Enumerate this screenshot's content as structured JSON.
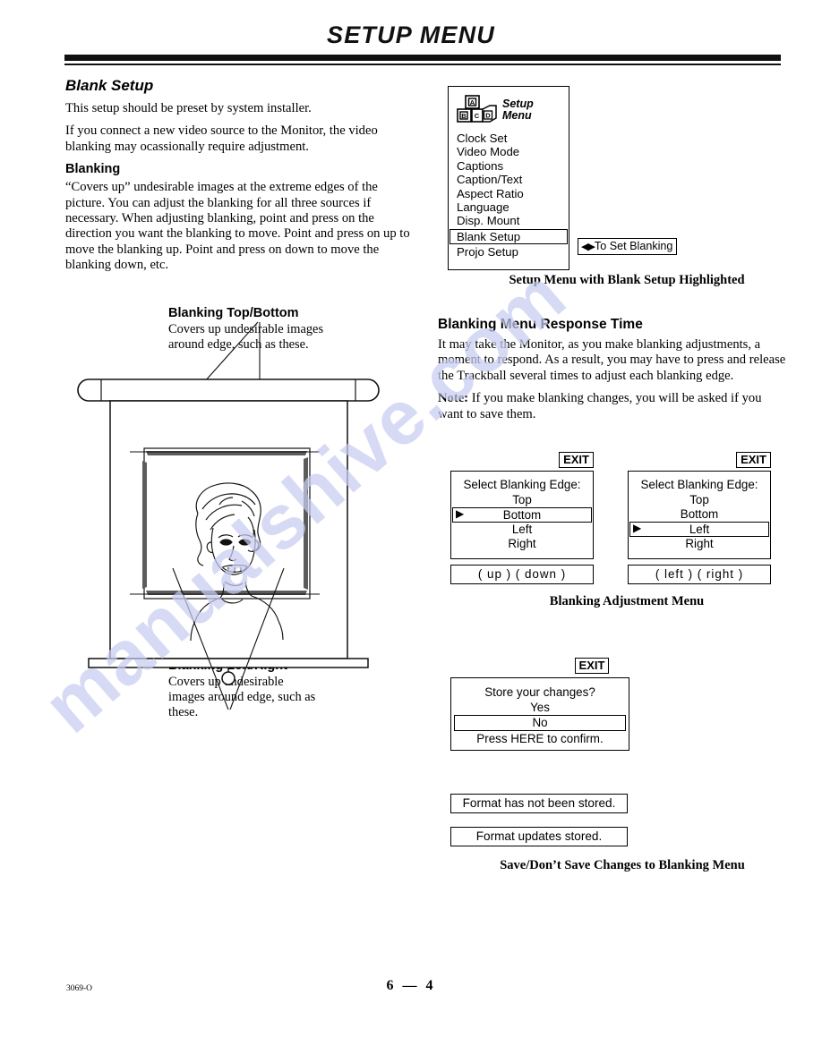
{
  "header": {
    "title": "SETUP MENU"
  },
  "left_column": {
    "section_title": "Blank Setup",
    "paragraph_1": "This setup should be preset by system installer.",
    "paragraph_2": "If you connect a new video source to the Monitor, the video blanking may ocassionally require adjustment.",
    "subsection_title": "Blanking",
    "paragraph_3": "“Covers up” undesirable images at the extreme edges of the picture. You can adjust the blanking for all three sources if necessary. When adjusting blanking, point and press on the direction you want the blanking to move. Point and press on up to move the blanking up. Point and press on down to move the blanking down, etc."
  },
  "setup_menu": {
    "icon_name": "alphabet-blocks-icon",
    "icon_letters": [
      "A",
      "B",
      "C",
      "D"
    ],
    "title_line_1": "Setup",
    "title_line_2": "Menu",
    "items": [
      {
        "label": "Clock Set",
        "selected": false
      },
      {
        "label": "Video Mode",
        "selected": false
      },
      {
        "label": "Captions",
        "selected": false
      },
      {
        "label": "Caption/Text",
        "selected": false
      },
      {
        "label": "Aspect Ratio",
        "selected": false
      },
      {
        "label": "Language",
        "selected": false
      },
      {
        "label": "Disp. Mount",
        "selected": false
      },
      {
        "label": "Blank Setup",
        "selected": true
      },
      {
        "label": "Projo Setup",
        "selected": false
      }
    ],
    "hint_arrows": "◀▶",
    "hint_label": "To Set Blanking",
    "caption": "Setup Menu with Blank Setup Highlighted"
  },
  "illustration": {
    "top_label_title": "Blanking Top/Bottom",
    "top_label_text": "Covers up undesirable images around edge, such as these.",
    "bottom_label_title": "Blanking Left/Right",
    "bottom_label_text": "Covers up undesirable images around edge, such as these.",
    "picture_alt": "projection screen with portrait"
  },
  "right_column": {
    "section_title": "Blanking Menu Response Time",
    "paragraph_1": "It may take the Monitor, as you make blanking adjustments, a moment to respond. As a result, you may have to press and release the Trackball several times to adjust each blanking edge.",
    "note_label": "Note:",
    "note_text": " If you make blanking changes, you will be asked if you want to save them."
  },
  "blanking_menus": {
    "exit_label": "EXIT",
    "caption": "Blanking Adjustment Menu",
    "menu_left": {
      "title": "Select Blanking Edge:",
      "options": [
        {
          "label": "Top",
          "selected": false
        },
        {
          "label": "Bottom",
          "selected": true
        },
        {
          "label": "Left",
          "selected": false
        },
        {
          "label": "Right",
          "selected": false
        }
      ],
      "cursor": "▶",
      "buttons": "(  up  )    (  down  )"
    },
    "menu_right": {
      "title": "Select Blanking Edge:",
      "options": [
        {
          "label": "Top",
          "selected": false
        },
        {
          "label": "Bottom",
          "selected": false
        },
        {
          "label": "Left",
          "selected": true
        },
        {
          "label": "Right",
          "selected": false
        }
      ],
      "cursor": "▶",
      "buttons": "(  left  )    (  right  )"
    }
  },
  "store_dialog": {
    "exit_label": "EXIT",
    "question": "Store your changes?",
    "option_yes": "Yes",
    "option_no": "No",
    "confirm_text": "Press HERE to confirm.",
    "message_not_stored": "Format has not been stored.",
    "message_stored": "Format updates stored.",
    "caption": "Save/Don’t Save Changes to Blanking Menu"
  },
  "footer": {
    "doc_code": "3069-O",
    "page_number": "6  —  4"
  },
  "watermark": {
    "text": "manualshive.com",
    "color": "#c9cdf0"
  }
}
